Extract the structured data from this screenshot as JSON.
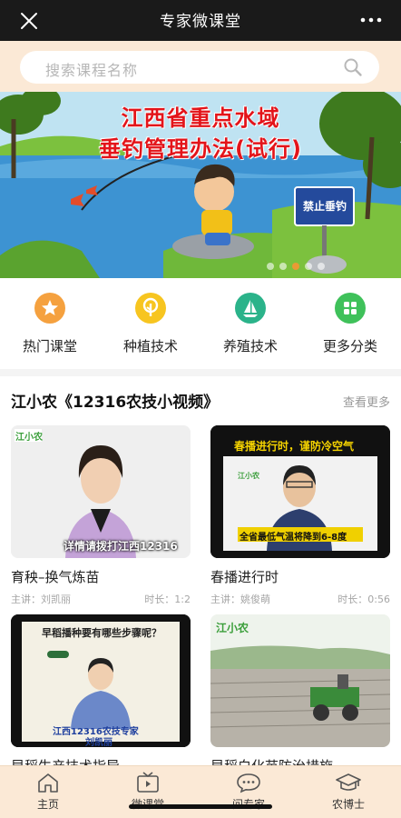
{
  "header": {
    "title": "专家微课堂",
    "close_icon": "close-icon",
    "more_icon": "more-dots-icon"
  },
  "search": {
    "placeholder": "搜索课程名称",
    "icon": "search-icon"
  },
  "banner": {
    "line1": "江西省重点水域",
    "line2": "垂钓管理办法(试行)",
    "sign": "禁止垂钓",
    "slide_count": 5,
    "active_slide": 2
  },
  "categories": [
    {
      "label": "热门课堂",
      "icon": "star-icon",
      "color": "#f5a13f"
    },
    {
      "label": "种植技术",
      "icon": "plant-icon",
      "color": "#f7c520"
    },
    {
      "label": "养殖技术",
      "icon": "sail-icon",
      "color": "#2bb38a"
    },
    {
      "label": "更多分类",
      "icon": "grid-icon",
      "color": "#3fc15a"
    }
  ],
  "section": {
    "title": "江小农《12316农技小视频》",
    "more": "查看更多"
  },
  "videos": [
    {
      "title": "育秧–换气炼苗",
      "speaker": "主讲：刘凯丽",
      "duration": "时长：1:2",
      "logo": "江小农",
      "caption": "详情请拨打江西12316"
    },
    {
      "title": "春播进行时",
      "speaker": "主讲：姚俊萌",
      "duration": "时长：0:56",
      "headline": "春播进行时，谨防冷空气",
      "logo": "江小农",
      "caption": "全省最低气温将降到6-8度"
    },
    {
      "title": "早稻生产技术指导",
      "headline": "早稻播种要有哪些步骤呢？",
      "caption": "江西12316农技专家",
      "name": "刘凯丽"
    },
    {
      "title": "早稻白化苗防治措施",
      "logo": "江小农"
    }
  ],
  "tabs": [
    {
      "label": "主页",
      "icon": "home-icon"
    },
    {
      "label": "微课堂",
      "icon": "tv-icon"
    },
    {
      "label": "问专家",
      "icon": "chat-icon"
    },
    {
      "label": "农博士",
      "icon": "graduation-cap-icon"
    }
  ]
}
